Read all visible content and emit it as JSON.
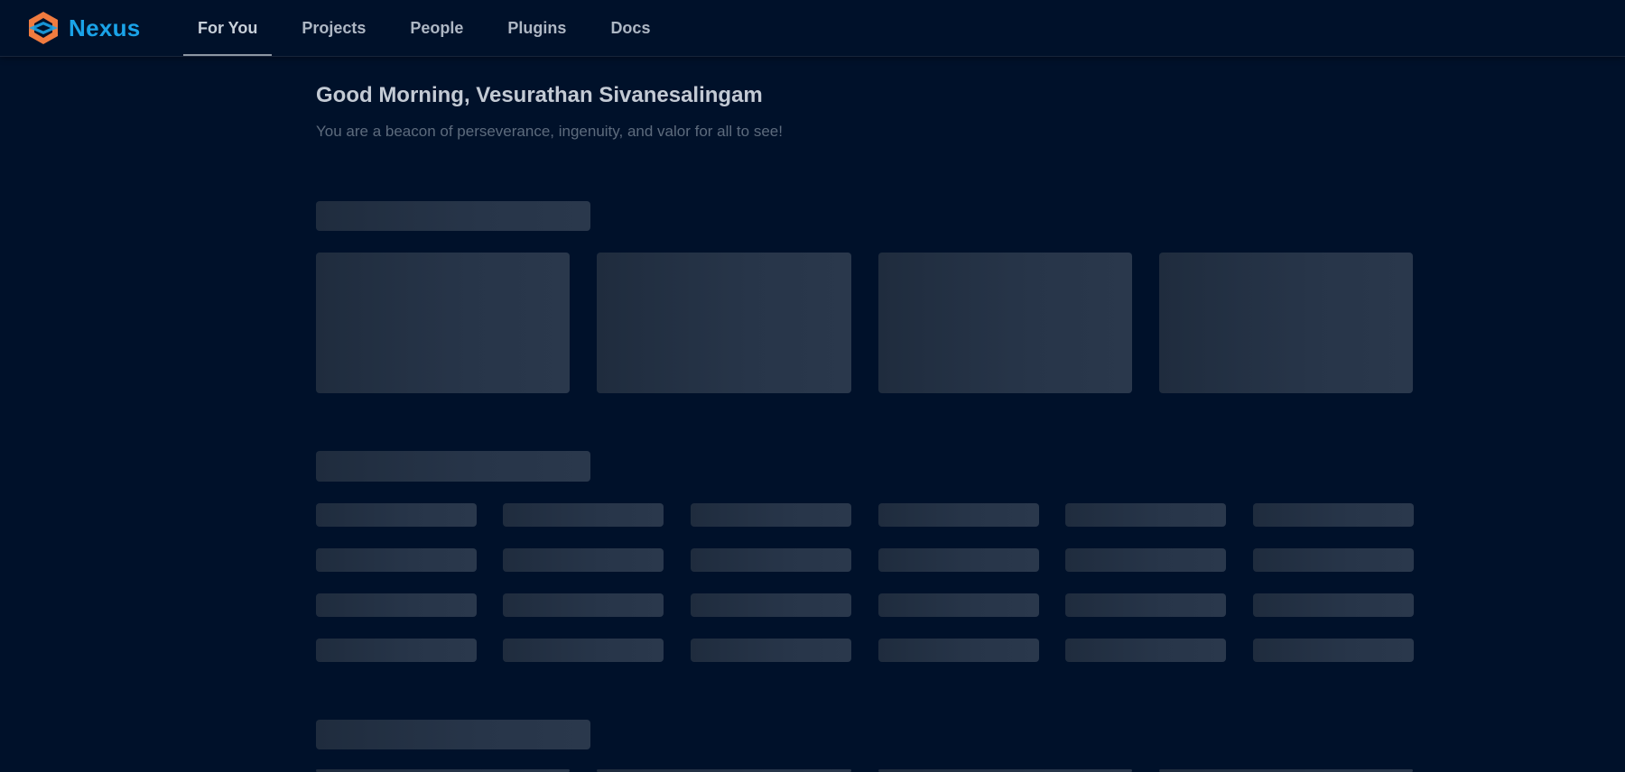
{
  "app": {
    "brand": "Nexus",
    "brand_colors": [
      "#f07b3f",
      "#1aa3e8"
    ],
    "logo_icon": "hexagon-logo-icon"
  },
  "nav": {
    "tabs": [
      {
        "label": "For You",
        "active": true
      },
      {
        "label": "Projects",
        "active": false
      },
      {
        "label": "People",
        "active": false
      },
      {
        "label": "Plugins",
        "active": false
      },
      {
        "label": "Docs",
        "active": false
      }
    ]
  },
  "main": {
    "greeting": "Good Morning, Vesurathan Sivanesalingam",
    "subtitle": "You are a beacon of perseverance, ingenuity, and valor for all to see!"
  },
  "theme": {
    "background": "#00112a",
    "skeleton": "#243246"
  }
}
